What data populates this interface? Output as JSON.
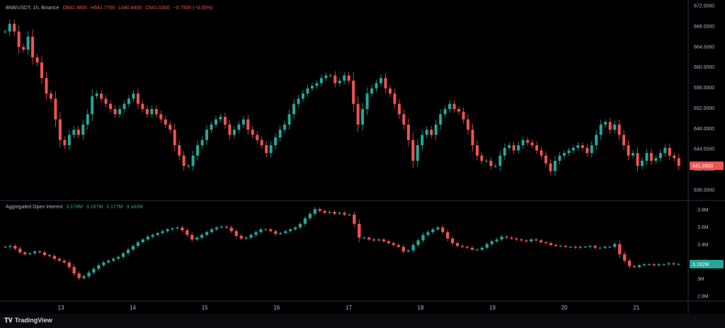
{
  "colors": {
    "up": "#26a69a",
    "down": "#ef5350",
    "bg": "#000000",
    "axis_text": "#b2b5be",
    "grid": "#2a2e39"
  },
  "legend": {
    "symbol": "BNB/USDT, 1h, Binance",
    "open": "O641.3800",
    "high": "H641.7700",
    "low": "L640.8400",
    "close": "C641.0300",
    "change": "−0.7500 (−0.05%)"
  },
  "oi_legend": {
    "title": "Aggregated Open Interest",
    "o": "3.178M",
    "h": "3.187M",
    "l": "3.177M",
    "c": "3.182M"
  },
  "footer": {
    "brand": "TradingView"
  },
  "chart_data": [
    {
      "type": "candlestick",
      "title": "BNB/USDT, 1h, Binance",
      "y_ticks": [
        "672.0000",
        "668.0000",
        "664.0000",
        "660.0000",
        "656.0000",
        "652.0000",
        "648.0000",
        "644.0000",
        "640.0000",
        "636.0000"
      ],
      "ylim": [
        635,
        672
      ],
      "x_ticks": [
        "13",
        "14",
        "15",
        "16",
        "17",
        "18",
        "19",
        "20",
        "21"
      ],
      "last_price": "641.0300",
      "close_series": [
        667,
        668.5,
        667,
        664,
        663.5,
        666,
        662,
        661,
        658,
        655,
        654,
        650,
        646,
        645,
        647,
        648,
        647,
        649,
        651,
        654.5,
        655,
        654,
        653,
        652,
        651,
        652,
        653,
        654,
        655,
        653,
        652,
        651,
        652,
        651,
        650,
        649,
        648,
        645,
        643,
        641,
        641,
        643,
        645,
        646,
        648,
        649,
        650,
        650.5,
        649,
        647,
        648,
        649,
        650,
        648,
        647,
        646,
        645,
        643.5,
        645,
        646.5,
        648,
        649,
        651,
        653,
        654,
        655,
        656,
        656.5,
        657,
        658,
        658.5,
        658.5,
        657,
        657.5,
        658.5,
        657.5,
        653,
        649,
        652,
        655,
        656,
        657,
        658,
        656,
        655,
        653,
        651,
        649,
        646,
        642,
        645,
        647,
        648,
        647,
        649,
        651,
        652,
        653,
        652,
        651.5,
        650,
        648,
        645,
        643,
        642,
        642,
        641,
        641,
        643,
        644.5,
        645,
        644,
        645,
        646,
        645.5,
        645,
        644,
        643,
        641.5,
        640,
        642,
        643,
        643.5,
        644,
        644.5,
        645,
        644.5,
        643.5,
        645,
        647,
        649,
        649.5,
        648,
        649,
        647,
        645,
        643,
        643.5,
        641,
        642,
        643.5,
        642,
        642.5,
        643.5,
        644.5,
        643,
        642.5,
        641.03
      ]
    },
    {
      "type": "candlestick",
      "title": "Aggregated Open Interest",
      "y_ticks": [
        "3.8M",
        "3.6M",
        "3.4M",
        "3.2M",
        "3M",
        "2.8M"
      ],
      "ylim": [
        2.78,
        3.82
      ],
      "x_ticks": [
        "13",
        "14",
        "15",
        "16",
        "17",
        "18",
        "19",
        "20",
        "21"
      ],
      "last_value": "3.182M",
      "close_series": [
        3.37,
        3.38,
        3.35,
        3.31,
        3.29,
        3.3,
        3.32,
        3.31,
        3.28,
        3.27,
        3.24,
        3.22,
        3.2,
        3.15,
        3.08,
        3.03,
        3.05,
        3.09,
        3.13,
        3.17,
        3.2,
        3.22,
        3.24,
        3.26,
        3.3,
        3.34,
        3.38,
        3.42,
        3.45,
        3.48,
        3.5,
        3.52,
        3.54,
        3.56,
        3.57,
        3.58,
        3.55,
        3.5,
        3.45,
        3.47,
        3.5,
        3.53,
        3.56,
        3.58,
        3.59,
        3.58,
        3.54,
        3.49,
        3.46,
        3.47,
        3.5,
        3.53,
        3.56,
        3.56,
        3.54,
        3.51,
        3.52,
        3.54,
        3.56,
        3.58,
        3.62,
        3.68,
        3.73,
        3.78,
        3.76,
        3.74,
        3.75,
        3.73,
        3.74,
        3.72,
        3.72,
        3.62,
        3.47,
        3.47,
        3.45,
        3.44,
        3.45,
        3.43,
        3.41,
        3.39,
        3.37,
        3.32,
        3.33,
        3.39,
        3.44,
        3.5,
        3.53,
        3.56,
        3.58,
        3.53,
        3.46,
        3.41,
        3.38,
        3.37,
        3.36,
        3.34,
        3.34,
        3.36,
        3.4,
        3.43,
        3.45,
        3.48,
        3.47,
        3.46,
        3.45,
        3.44,
        3.43,
        3.45,
        3.44,
        3.42,
        3.41,
        3.39,
        3.38,
        3.38,
        3.37,
        3.37,
        3.36,
        3.37,
        3.37,
        3.38,
        3.36,
        3.36,
        3.37,
        3.37,
        3.4,
        3.29,
        3.22,
        3.16,
        3.15,
        3.17,
        3.18,
        3.18,
        3.17,
        3.18,
        3.18,
        3.19,
        3.18,
        3.182
      ]
    }
  ]
}
